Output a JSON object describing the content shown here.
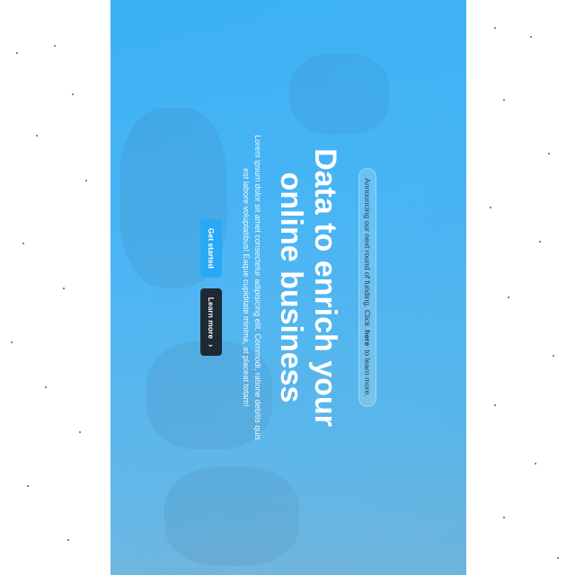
{
  "hero": {
    "announcement": {
      "prefix": "Announcing our next round of funding. Click",
      "link": "here",
      "suffix": "to learn more."
    },
    "title": "Data to enrich your online business",
    "subtitle": "Lorem ipsum dolor sit amet consectetur adipisicing elit. Commodi, ratione debitis quis est labore voluptatibus! Eaque cupiditate minima, at placeat totam!",
    "buttons": {
      "primary": "Get started",
      "secondary": "Learn more"
    },
    "icons": {
      "secondary_button": "chevron-right-icon"
    }
  },
  "colors": {
    "hero_gradient_start": "#38b1f4",
    "hero_gradient_end": "#8ab6cf",
    "primary_button": "#29a8f5",
    "secondary_button": "#1f2933",
    "text": "#ffffff"
  }
}
